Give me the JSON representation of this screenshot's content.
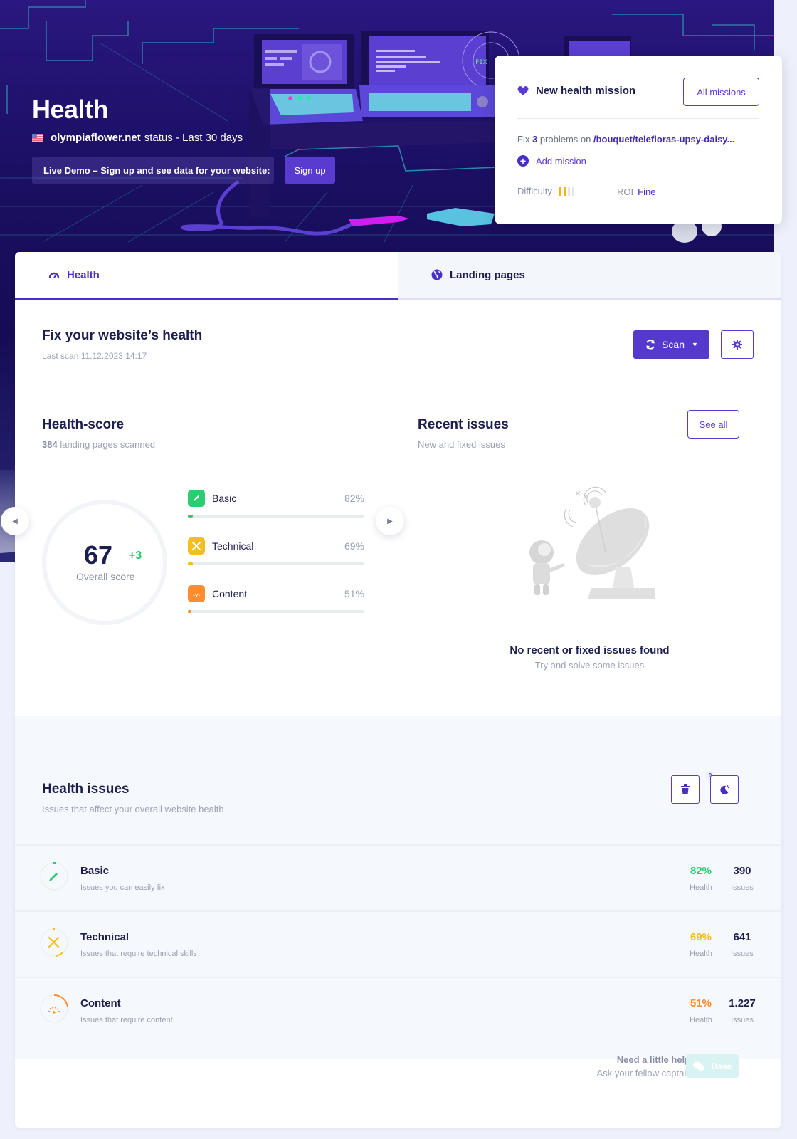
{
  "hero": {
    "title": "Health",
    "domain": "olympiaflower.net",
    "status_suffix": "status - Last 30 days",
    "demo_text": "Live Demo – Sign up and see data for your website:",
    "signup_label": "Sign up"
  },
  "mission": {
    "title": "New health mission",
    "all_missions_label": "All missions",
    "fix_prefix": "Fix",
    "fix_count": "3",
    "fix_middle": "problems on",
    "fix_path": "/bouquet/telefloras-upsy-daisy...",
    "add_mission_label": "Add mission",
    "difficulty_label": "Difficulty",
    "difficulty_level": 2,
    "difficulty_max": 4,
    "roi_label": "ROI",
    "roi_value": "Fine"
  },
  "tabs": [
    {
      "label": "Health",
      "icon": "gauge-icon",
      "active": true
    },
    {
      "label": "Landing pages",
      "icon": "globe-icon",
      "active": false
    }
  ],
  "fix_section": {
    "title": "Fix your website’s health",
    "last_scan": "Last scan 11.12.2023 14:17",
    "scan_label": "Scan"
  },
  "health_score": {
    "title": "Health-score",
    "pages_count": "384",
    "pages_suffix": "landing pages scanned",
    "score": "67",
    "delta": "+3",
    "score_label": "Overall score",
    "categories": [
      {
        "name": "Basic",
        "pct": "82%",
        "color": "#2ecc71",
        "fill_fraction": 0.03
      },
      {
        "name": "Technical",
        "pct": "69%",
        "color": "#f2c01e",
        "fill_fraction": 0.03
      },
      {
        "name": "Content",
        "pct": "51%",
        "color": "#ff8c2e",
        "fill_fraction": 0.02
      }
    ]
  },
  "recent_issues": {
    "title": "Recent issues",
    "subtitle": "New and fixed issues",
    "see_all_label": "See all",
    "empty_title": "No recent or fixed issues found",
    "empty_sub": "Try and solve some issues"
  },
  "health_issues": {
    "title": "Health issues",
    "subtitle": "Issues that affect your overall website health",
    "trash_count": "0",
    "rows": [
      {
        "name": "Basic",
        "desc": "Issues you can easily fix",
        "health": "82%",
        "health_label": "Health",
        "issues": "390",
        "issues_label": "Issues",
        "color": "#2ecc71"
      },
      {
        "name": "Technical",
        "desc": "Issues that require technical skills",
        "health": "69%",
        "health_label": "Health",
        "issues": "641",
        "issues_label": "Issues",
        "color": "#f2c01e"
      },
      {
        "name": "Content",
        "desc": "Issues that require content",
        "health": "51%",
        "health_label": "Health",
        "issues": "1.227",
        "issues_label": "Issues",
        "color": "#ff8c2e"
      }
    ]
  },
  "help": {
    "question": "Need a little help?",
    "sub": "Ask your fellow captains",
    "base_label": "Base"
  }
}
